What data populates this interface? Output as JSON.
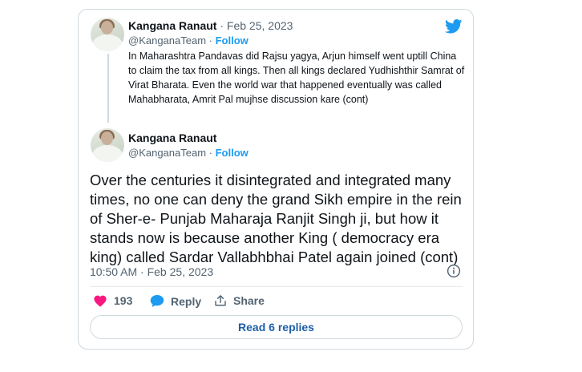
{
  "quoted_tweet": {
    "author_name": "Kangana Ranaut",
    "separator": " · ",
    "date": "Feb 25, 2023",
    "handle": "@KanganaTeam",
    "follow_label": "Follow",
    "text": "In Maharashtra Pandavas did Rajsu yagya, Arjun himself went uptill China to claim the tax from all kings. Then all kings declared Yudhishthir Samrat of Virat Bharata. Even the world war that happened eventually was called Mahabharata, Amrit Pal mujhse discussion kare (cont)"
  },
  "main_tweet": {
    "author_name": "Kangana Ranaut",
    "handle": "@KanganaTeam",
    "separator": " · ",
    "follow_label": "Follow",
    "text": "Over the centuries it disintegrated and integrated many times, no one can deny the grand Sikh empire in the rein of Sher-e- Punjab Maharaja Ranjit Singh ji, but how it stands now is because another King ( democracy era king) called Sardar Vallabhbhai Patel again joined (cont)",
    "timestamp": "10:50 AM · Feb 25, 2023",
    "likes": "193",
    "reply_label": "Reply",
    "share_label": "Share",
    "read_replies_label": "Read 6 replies"
  },
  "icons": {
    "brand": "twitter-bird-icon",
    "info": "info-icon",
    "like": "heart-icon",
    "reply": "speech-bubble-icon",
    "share": "share-arrow-icon"
  },
  "colors": {
    "brand_blue": "#1d9bf0",
    "like_pink": "#f91880",
    "secondary_text": "#536471",
    "border": "#cfd9de"
  }
}
